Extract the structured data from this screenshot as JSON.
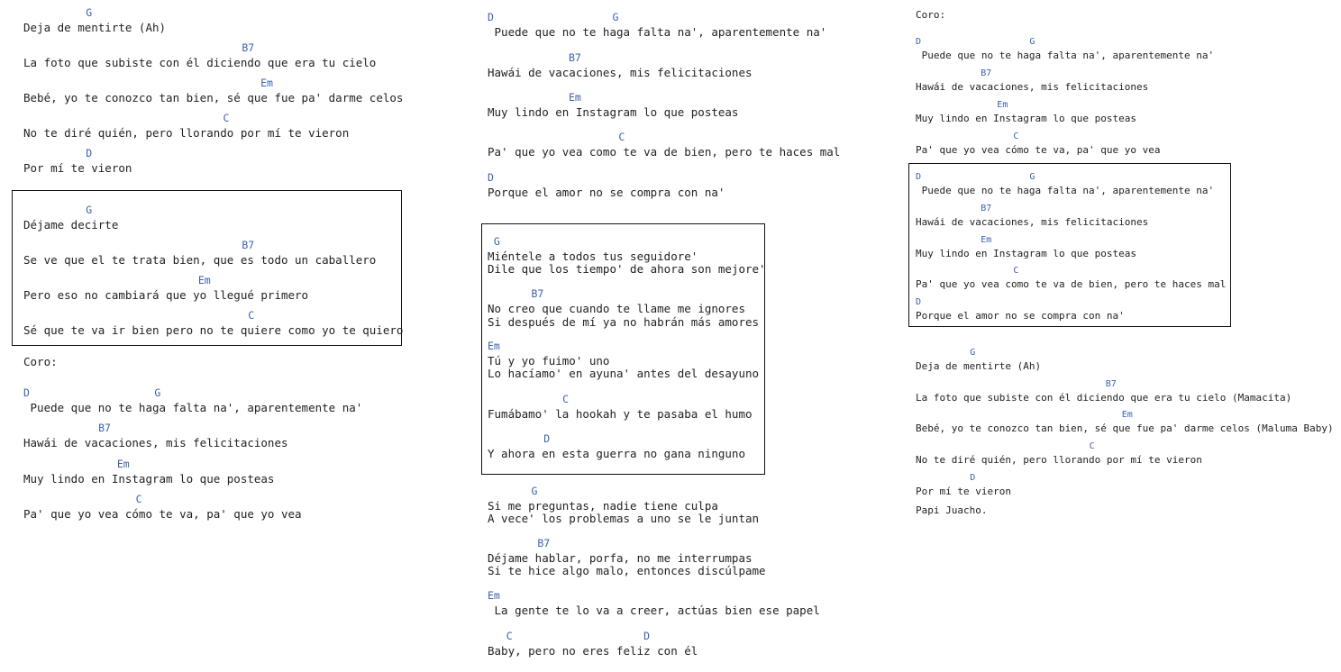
{
  "colors": {
    "chord": "#3a62b0",
    "lyric": "#222222",
    "box_border": "#111111",
    "background": "#ffffff"
  },
  "col1": [
    {
      "chord": "          G",
      "text": "Deja de mentirte (Ah)"
    },
    {
      "chord": "                                   B7",
      "text": "La foto que subiste con él diciendo que era tu cielo"
    },
    {
      "chord": "                                      Em",
      "text": "Bebé, yo te conozco tan bien, sé que fue pa' darme celos"
    },
    {
      "chord": "                                C",
      "text": "No te diré quién, pero llorando por mí te vieron"
    },
    {
      "chord": "          D",
      "text": "Por mí te vieron"
    },
    {
      "chord": "          G",
      "text": "Déjame decirte"
    },
    {
      "chord": "                                   B7",
      "text": "Se ve que el te trata bien, que es todo un caballero"
    },
    {
      "chord": "                            Em",
      "text": "Pero eso no cambiará que yo llegué primero"
    },
    {
      "chord": "                                    C",
      "text": "Sé que te va ir bien pero no te quiere como yo te quiero"
    },
    {
      "text": "Coro:"
    },
    {
      "chord": "D                    G",
      "text": " Puede que no te haga falta na', aparentemente na'"
    },
    {
      "chord": "            B7",
      "text": "Hawái de vacaciones, mis felicitaciones"
    },
    {
      "chord": "               Em",
      "text": "Muy lindo en Instagram lo que posteas"
    },
    {
      "chord": "                  C",
      "text": "Pa' que yo vea cómo te va, pa' que yo vea"
    }
  ],
  "col2": [
    {
      "chord": "D                   G",
      "text": " Puede que no te haga falta na', aparentemente na'"
    },
    {
      "chord": "             B7",
      "text": "Hawái de vacaciones, mis felicitaciones"
    },
    {
      "chord": "             Em",
      "text": "Muy lindo en Instagram lo que posteas"
    },
    {
      "chord": "                     C",
      "text": "Pa' que yo vea como te va de bien, pero te haces mal"
    },
    {
      "chord": "D",
      "text": "Porque el amor no se compra con na'"
    },
    {
      "chord": " G",
      "text": "Miéntele a todos tus seguidore'"
    },
    {
      "text": "Dile que los tiempo' de ahora son mejore'"
    },
    {
      "chord": "       B7",
      "text": "No creo que cuando te llame me ignores"
    },
    {
      "text": "Si después de mí ya no habrán más amores"
    },
    {
      "chord": "Em",
      "text": "Tú y yo fuimo' uno"
    },
    {
      "text": "Lo hacíamo' en ayuna' antes del desayuno"
    },
    {
      "chord": "            C",
      "text": "Fumábamo' la hookah y te pasaba el humo"
    },
    {
      "chord": "         D",
      "text": "Y ahora en esta guerra no gana ninguno"
    },
    {
      "chord": "       G",
      "text": "Si me preguntas, nadie tiene culpa"
    },
    {
      "text": "A vece' los problemas a uno se le juntan"
    },
    {
      "chord": "        B7",
      "text": "Déjame hablar, porfa, no me interrumpas"
    },
    {
      "text": "Si te hice algo malo, entonces discúlpame"
    },
    {
      "chord": "Em",
      "text": " La gente te lo va a creer, actúas bien ese papel"
    },
    {
      "chord": "   C                     D",
      "text": "Baby, pero no eres feliz con él"
    }
  ],
  "col3": [
    {
      "text": "Coro:"
    },
    {
      "chord": "D                    G",
      "text": " Puede que no te haga falta na', aparentemente na'"
    },
    {
      "chord": "            B7",
      "text": "Hawái de vacaciones, mis felicitaciones"
    },
    {
      "chord": "               Em",
      "text": "Muy lindo en Instagram lo que posteas"
    },
    {
      "chord": "                  C",
      "text": "Pa' que yo vea cómo te va, pa' que yo vea"
    },
    {
      "chord": "D                    G",
      "text": " Puede que no te haga falta na', aparentemente na'"
    },
    {
      "chord": "            B7",
      "text": "Hawái de vacaciones, mis felicitaciones"
    },
    {
      "chord": "            Em",
      "text": "Muy lindo en Instagram lo que posteas"
    },
    {
      "chord": "                  C",
      "text": "Pa' que yo vea como te va de bien, pero te haces mal"
    },
    {
      "chord": "D",
      "text": "Porque el amor no se compra con na'"
    },
    {
      "chord": "          G",
      "text": "Deja de mentirte (Ah)"
    },
    {
      "chord": "                                   B7",
      "text": "La foto que subiste con él diciendo que era tu cielo (Mamacita)"
    },
    {
      "chord": "                                      Em",
      "text": "Bebé, yo te conozco tan bien, sé que fue pa' darme celos (Maluma Baby)"
    },
    {
      "chord": "                                C",
      "text": "No te diré quién, pero llorando por mí te vieron"
    },
    {
      "chord": "          D",
      "text": "Por mí te vieron"
    },
    {
      "text": "Papi Juacho."
    }
  ]
}
